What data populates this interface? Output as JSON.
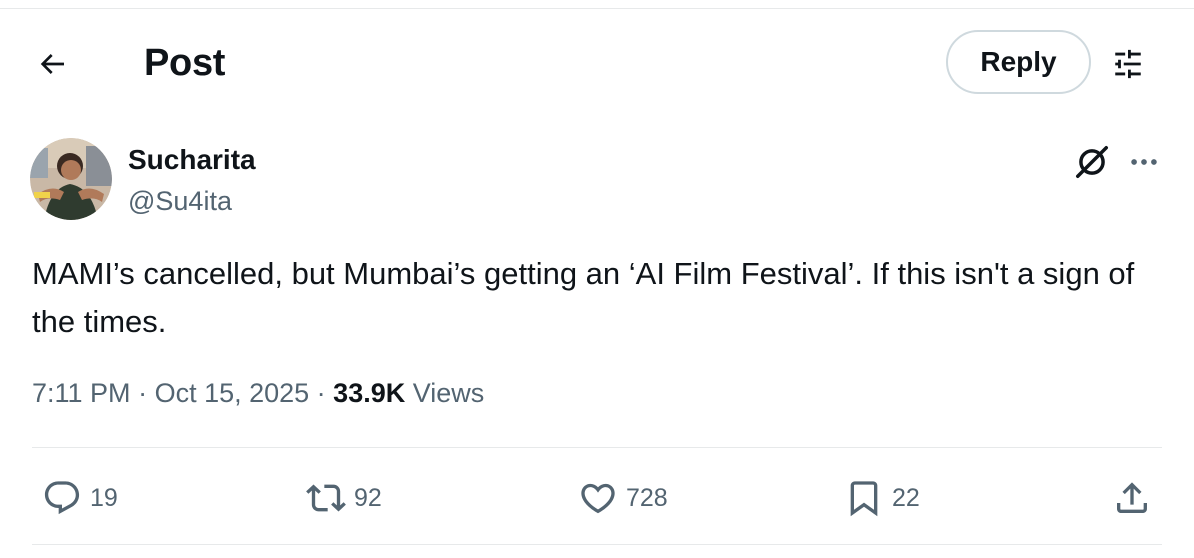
{
  "header": {
    "title": "Post",
    "back_icon": "arrow-left-icon",
    "reply_label": "Reply",
    "filter_icon": "sliders-icon"
  },
  "author": {
    "name": "Sucharita",
    "handle": "@Su4ita",
    "avatar": "avatar-photo",
    "grok_icon": "grok-icon",
    "more_icon": "more-dots-icon"
  },
  "post": {
    "text": "MAMI’s cancelled, but Mumbai’s getting an ‘AI Film Festival’. If this isn't a sign of the times.",
    "time": "7:11 PM",
    "sep1": " · ",
    "date": "Oct 15, 2025",
    "sep2": " · ",
    "views_count": "33.9K",
    "views_label": " Views"
  },
  "actions": {
    "replies": "19",
    "reposts": "92",
    "likes": "728",
    "bookmarks": "22",
    "share_icon": "share-icon"
  },
  "colors": {
    "text_primary": "#0f1419",
    "text_secondary": "#536471",
    "border": "#cfd9de",
    "divider": "#e7e9ea"
  }
}
